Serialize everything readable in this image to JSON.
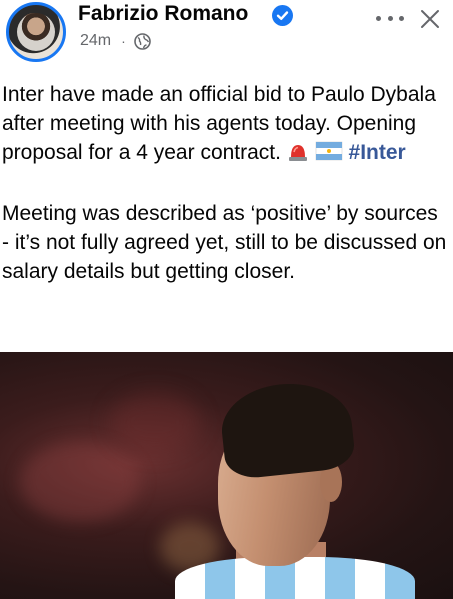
{
  "post": {
    "author": "Fabrizio Romano",
    "timestamp": "24m",
    "separator": "·",
    "paragraph1_text": "Inter have made an official bid to Paulo Dybala after meeting with his agents today. Opening proposal for a 4 year contract.",
    "hashtag": "#Inter",
    "paragraph2": "Meeting was described as ‘positive’ by sources - it’s not fully agreed yet, still to be discussed on salary details but getting closer."
  },
  "icons": {
    "verified": "verified-badge-icon",
    "privacy": "globe-icon",
    "more": "more-options-icon",
    "close": "close-icon",
    "emoji1": "siren-emoji",
    "emoji2": "argentina-flag-emoji"
  },
  "colors": {
    "verified_blue": "#1877f2",
    "hashtag": "#385898",
    "meta_text": "#65676b"
  }
}
